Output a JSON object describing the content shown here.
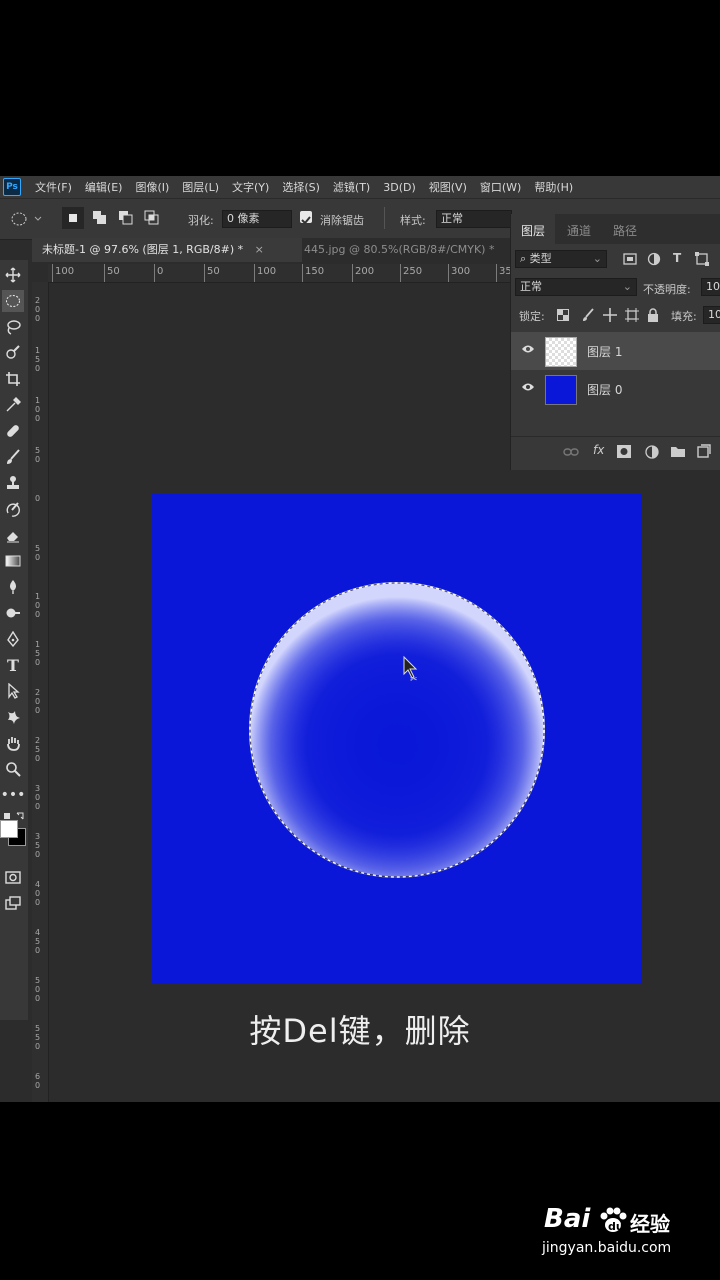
{
  "app": {
    "logo": "Ps"
  },
  "menu": [
    "文件(F)",
    "编辑(E)",
    "图像(I)",
    "图层(L)",
    "文字(Y)",
    "选择(S)",
    "滤镜(T)",
    "3D(D)",
    "视图(V)",
    "窗口(W)",
    "帮助(H)"
  ],
  "options": {
    "feather_label": "羽化:",
    "feather_value": "0 像素",
    "antialias_label": "消除锯齿",
    "style_label": "样式:",
    "style_value": "正常"
  },
  "tabs": {
    "active": "未标题-1 @ 97.6% (图层 1, RGB/8#) *",
    "inactive": "445.jpg @ 80.5%(RGB/8#/CMYK) *"
  },
  "ruler": {
    "h_labels": [
      "100",
      "50",
      "0",
      "50",
      "100",
      "150",
      "200",
      "250",
      "300",
      "35"
    ],
    "v_labels": [
      "200",
      "150",
      "100",
      "50",
      "0",
      "50",
      "100",
      "150",
      "200",
      "250",
      "300",
      "350",
      "400",
      "450",
      "500",
      "550",
      "60"
    ]
  },
  "layers_panel": {
    "tabs": [
      "图层",
      "通道",
      "路径"
    ],
    "filter_label": "类型",
    "blend_mode": "正常",
    "opacity_label": "不透明度:",
    "opacity_value": "10",
    "lock_label": "锁定:",
    "fill_label": "填充:",
    "fill_value": "10",
    "layers": [
      {
        "name": "图层 1",
        "selected": true
      },
      {
        "name": "图层 0",
        "selected": false
      }
    ]
  },
  "canvas": {
    "background_color": "#0a17d8"
  },
  "caption": "按Del键，删除",
  "watermark": {
    "brand": "Bai",
    "brand2": "经验",
    "url": "jingyan.baidu.com"
  },
  "colors": {
    "accent": "#31a8ff",
    "ui_bg": "#2c2c2c"
  }
}
